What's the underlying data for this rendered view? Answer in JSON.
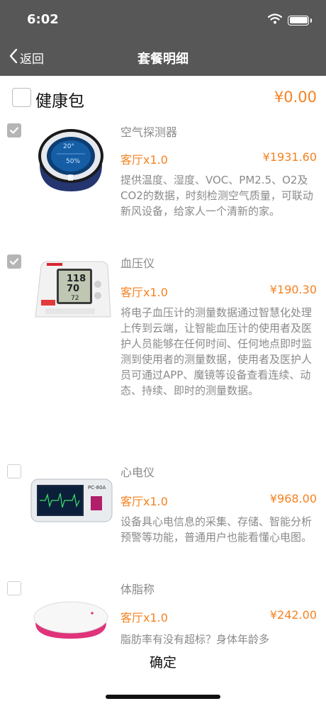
{
  "status_bar": {
    "time": "6:02"
  },
  "nav": {
    "back_label": "返回",
    "title": "套餐明细"
  },
  "package": {
    "name": "健康包",
    "price": "¥0.00",
    "checked": false
  },
  "items": [
    {
      "name": "空气探测器",
      "room": "客厅x1.0",
      "price": "¥1931.60",
      "checked": true,
      "description": "提供温度、湿度、VOC、PM2.5、O2及CO2的数据，时刻检测空气质量，可联动新风设备，给家人一个清新的家。",
      "image_readout": [
        "20°",
        "50%"
      ]
    },
    {
      "name": "血压仪",
      "room": "客厅x1.0",
      "price": "¥190.30",
      "checked": true,
      "description": "将电子血压计的测量数据通过智慧化处理上传到云端，让智能血压计的使用者及医护人员能够在任何时间、任何地点即时监测到使用者的测量数据，使用者及医护人员可通过APP、魔镜等设备查看连续、动态、持续、即时的测量数据。",
      "image_readout": [
        "118",
        "70",
        "72"
      ]
    },
    {
      "name": "心电仪",
      "room": "客厅x1.0",
      "price": "¥968.00",
      "checked": false,
      "description": "设备具心电信息的采集、存储、智能分析预警等功能，普通用户也能看懂心电图。",
      "image_readout": [
        "PC-80A"
      ]
    },
    {
      "name": "体脂称",
      "room": "客厅x1.0",
      "price": "¥242.00",
      "checked": false,
      "description": "脂肪率有没有超标？身体年龄多",
      "image_readout": []
    }
  ],
  "footer": {
    "confirm_label": "确定"
  },
  "colors": {
    "accent": "#f58220",
    "header_bg": "#575757",
    "muted_text": "#8a8a8a"
  }
}
